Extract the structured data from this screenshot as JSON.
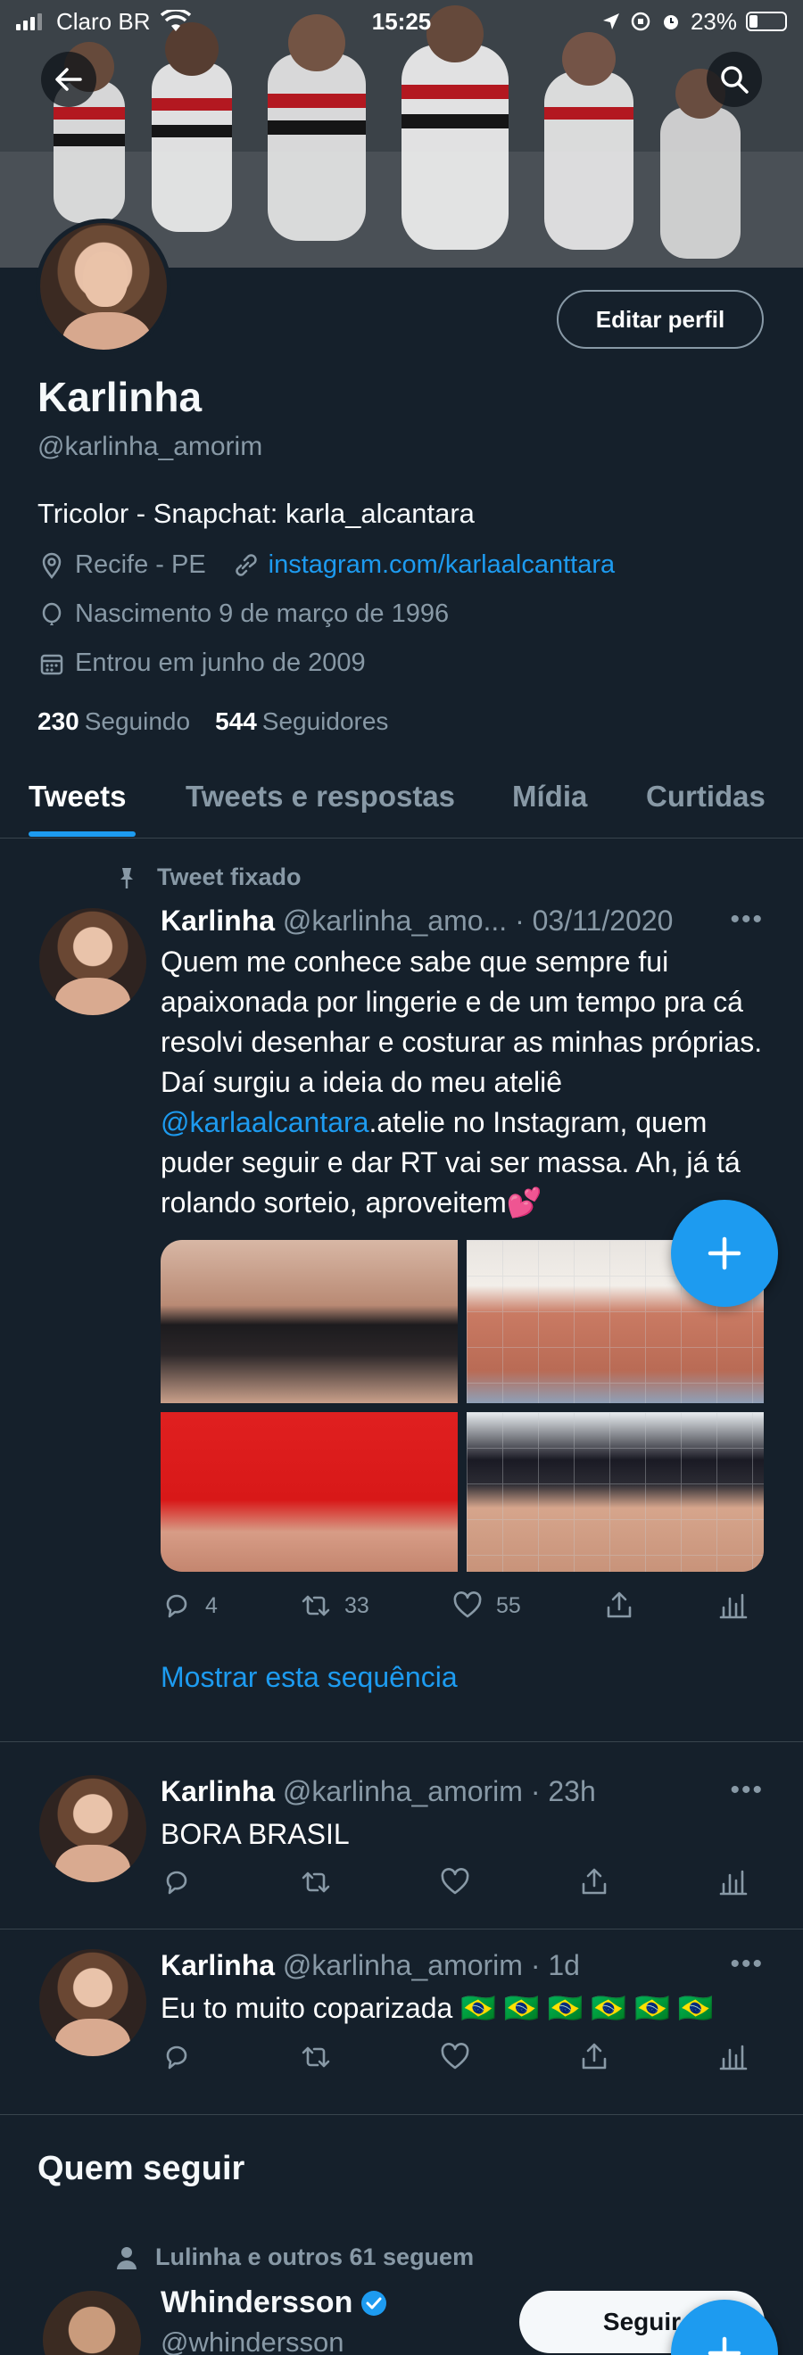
{
  "status_bar": {
    "carrier": "Claro BR",
    "time": "15:25",
    "battery": "23%"
  },
  "profile": {
    "name": "Karlinha",
    "handle": "@karlinha_amorim",
    "bio": "Tricolor - Snapchat: karla_alcantara",
    "location": "Recife - PE",
    "website": "instagram.com/karlaalcanttara",
    "birth": "Nascimento 9 de março de 1996",
    "joined": "Entrou em junho de 2009",
    "following_count": "230",
    "following_label": "Seguindo",
    "followers_count": "544",
    "followers_label": "Seguidores",
    "edit_label": "Editar perfil"
  },
  "tabs": [
    "Tweets",
    "Tweets e respostas",
    "Mídia",
    "Curtidas"
  ],
  "pinned_label": "Tweet fixado",
  "tweets": [
    {
      "name": "Karlinha",
      "handle": "@karlinha_amo...",
      "time": "· 03/11/2020",
      "text_before": "Quem me conhece sabe que sempre fui apaixonada por lingerie e de um tempo pra cá resolvi desenhar e costurar as minhas próprias. Daí surgiu a ideia do meu ateliê ",
      "mention": "@karlaalcantara",
      "text_after": ".atelie no Instagram, quem puder seguir e dar RT vai ser massa. Ah, já tá rolando sorteio, aproveitem💕",
      "replies": "4",
      "retweets": "33",
      "likes": "55",
      "thread_link": "Mostrar esta sequência"
    },
    {
      "name": "Karlinha",
      "handle": "@karlinha_amorim",
      "time": "· 23h",
      "text": "BORA BRASIL"
    },
    {
      "name": "Karlinha",
      "handle": "@karlinha_amorim",
      "time": "· 1d",
      "text": "Eu to muito coparizada 🇧🇷 🇧🇷 🇧🇷 🇧🇷 🇧🇷 🇧🇷"
    }
  ],
  "who_to_follow": {
    "title": "Quem seguir",
    "social": "Lulinha e outros 61 seguem",
    "name": "Whindersson",
    "handle": "@whindersson",
    "follow_label": "Seguir"
  },
  "icons": {
    "back": "arrow-left-icon",
    "search": "search-icon",
    "location": "location-pin-icon",
    "link": "link-icon",
    "birth": "balloon-icon",
    "calendar": "calendar-icon",
    "pin": "pin-icon",
    "reply": "reply-icon",
    "retweet": "retweet-icon",
    "like": "heart-icon",
    "share": "share-icon",
    "analytics": "analytics-icon",
    "compose": "plus-icon",
    "verified": "verified-badge-icon"
  },
  "colors": {
    "accent": "#1d9bf0",
    "background": "#15202b",
    "muted": "#8899a6"
  }
}
